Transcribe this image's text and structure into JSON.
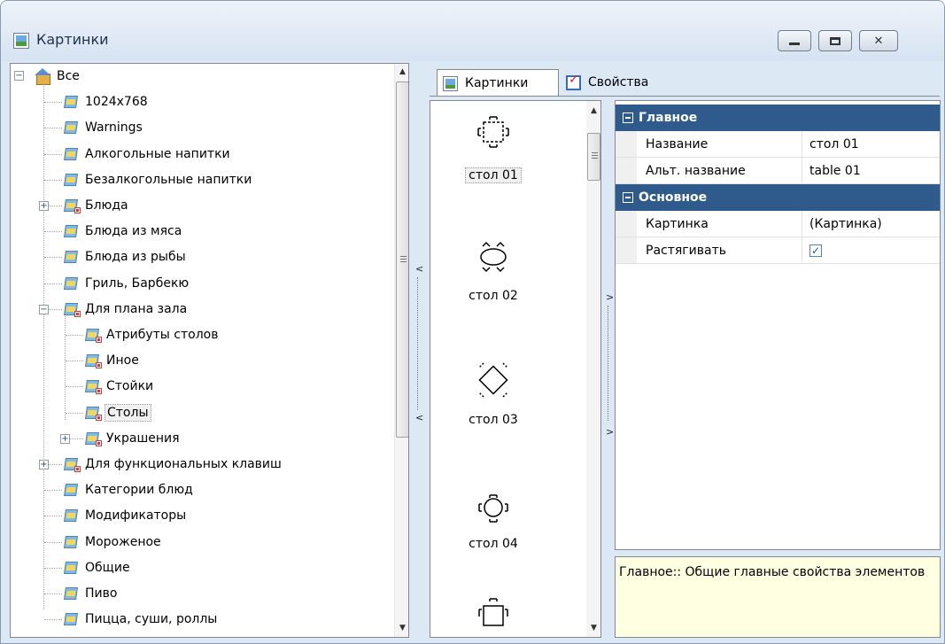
{
  "window": {
    "title": "Картинки",
    "controls": [
      "minimize",
      "maximize",
      "close"
    ]
  },
  "tree": {
    "root": "Все",
    "items": [
      {
        "label": "1024x768",
        "level": 1
      },
      {
        "label": "Warnings",
        "level": 1
      },
      {
        "label": "Алкогольные напитки",
        "level": 1
      },
      {
        "label": "Безалкогольные напитки",
        "level": 1
      },
      {
        "label": "Блюда",
        "level": 1,
        "expander": "+"
      },
      {
        "label": "Блюда из мяса",
        "level": 1
      },
      {
        "label": "Блюда из рыбы",
        "level": 1
      },
      {
        "label": "Гриль, Барбекю",
        "level": 1
      },
      {
        "label": "Для плана зала",
        "level": 1,
        "expander": "-"
      },
      {
        "label": "Атрибуты столов",
        "level": 2
      },
      {
        "label": "Иное",
        "level": 2
      },
      {
        "label": "Стойки",
        "level": 2
      },
      {
        "label": "Столы",
        "level": 2,
        "selected": true
      },
      {
        "label": "Украшения",
        "level": 2,
        "expander": "+"
      },
      {
        "label": "Для функциональных клавиш",
        "level": 1,
        "expander": "+"
      },
      {
        "label": "Категории блюд",
        "level": 1
      },
      {
        "label": "Модификаторы",
        "level": 1
      },
      {
        "label": "Мороженое",
        "level": 1
      },
      {
        "label": "Общие",
        "level": 1
      },
      {
        "label": "Пиво",
        "level": 1
      },
      {
        "label": "Пицца, суши, роллы",
        "level": 1
      }
    ]
  },
  "tabs": [
    {
      "label": "Картинки",
      "icon": "picture-icon",
      "active": true
    },
    {
      "label": "Свойства",
      "icon": "properties-icon",
      "active": false
    }
  ],
  "gallery": {
    "items": [
      {
        "label": "стол 01",
        "selected": true
      },
      {
        "label": "стол 02",
        "selected": false
      },
      {
        "label": "стол 03",
        "selected": false
      },
      {
        "label": "стол 04",
        "selected": false
      }
    ]
  },
  "properties": {
    "categories": [
      {
        "name": "Главное",
        "rows": [
          {
            "name": "Название",
            "value": "стол 01"
          },
          {
            "name": "Альт. название",
            "value": "table 01"
          }
        ]
      },
      {
        "name": "Основное",
        "rows": [
          {
            "name": "Картинка",
            "value": "(Картинка)"
          },
          {
            "name": "Растягивать",
            "value": "",
            "checkbox": true
          }
        ]
      }
    ],
    "description": "Главное:: Общие главные свойства элементов"
  }
}
